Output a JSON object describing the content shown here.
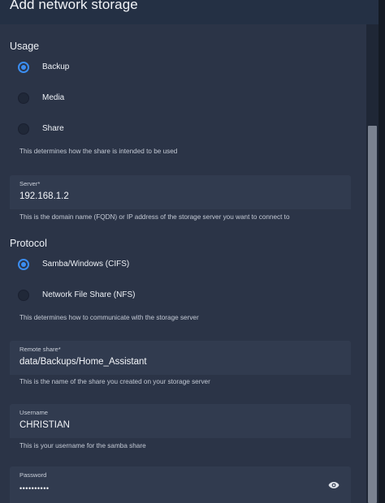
{
  "dialog": {
    "title": "Add network storage"
  },
  "usage": {
    "heading": "Usage",
    "options": [
      {
        "label": "Backup",
        "checked": true
      },
      {
        "label": "Media",
        "checked": false
      },
      {
        "label": "Share",
        "checked": false
      }
    ],
    "helper": "This determines how the share is intended to be used"
  },
  "server": {
    "label": "Server*",
    "value": "192.168.1.2",
    "helper": "This is the domain name (FQDN) or IP address of the storage server you want to connect to"
  },
  "protocol": {
    "heading": "Protocol",
    "options": [
      {
        "label": "Samba/Windows (CIFS)",
        "checked": true
      },
      {
        "label": "Network File Share (NFS)",
        "checked": false
      }
    ],
    "helper": "This determines how to communicate with the storage server"
  },
  "remote_share": {
    "label": "Remote share*",
    "value": "data/Backups/Home_Assistant",
    "helper": "This is the name of the share you created on your storage server"
  },
  "username": {
    "label": "Username",
    "value": "CHRISTIAN",
    "helper": "This is your username for the samba share"
  },
  "password": {
    "label": "Password",
    "value": "••••••••••",
    "icon": "eye-icon"
  },
  "colors": {
    "accent": "#3b8df0",
    "background": "#2b3447",
    "field": "#313b4f"
  }
}
